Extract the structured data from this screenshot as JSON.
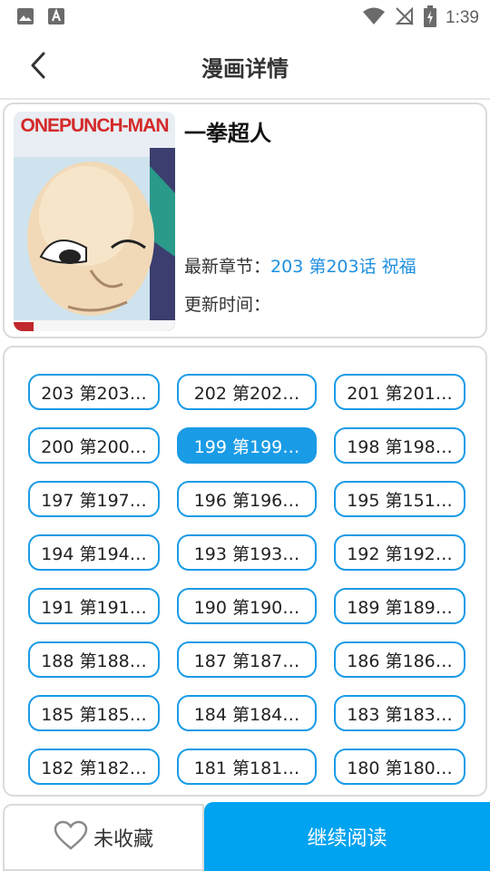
{
  "status_bar": {
    "time": "1:39",
    "icons": [
      "image-icon",
      "text-a-icon",
      "wifi-icon",
      "no-signal-icon",
      "battery-charging-icon"
    ]
  },
  "header": {
    "title": "漫画详情",
    "back_icon": "chevron-left-icon"
  },
  "comic": {
    "title": "一拳超人",
    "cover_logo": "ONEPUNCH-MAN",
    "latest_label": "最新章节：",
    "latest_value": "203 第203话 祝福",
    "update_label": "更新时间：",
    "update_value": ""
  },
  "chapters": [
    {
      "label": "203 第203…",
      "active": false
    },
    {
      "label": "202 第202…",
      "active": false
    },
    {
      "label": "201 第201…",
      "active": false
    },
    {
      "label": "200 第200…",
      "active": false
    },
    {
      "label": "199 第199…",
      "active": true
    },
    {
      "label": "198 第198…",
      "active": false
    },
    {
      "label": "197 第197…",
      "active": false
    },
    {
      "label": "196 第196…",
      "active": false
    },
    {
      "label": "195 第151…",
      "active": false
    },
    {
      "label": "194 第194…",
      "active": false
    },
    {
      "label": "193 第193…",
      "active": false
    },
    {
      "label": "192 第192…",
      "active": false
    },
    {
      "label": "191 第191…",
      "active": false
    },
    {
      "label": "190 第190…",
      "active": false
    },
    {
      "label": "189 第189…",
      "active": false
    },
    {
      "label": "188 第188…",
      "active": false
    },
    {
      "label": "187 第187…",
      "active": false
    },
    {
      "label": "186 第186…",
      "active": false
    },
    {
      "label": "185 第185…",
      "active": false
    },
    {
      "label": "184 第184…",
      "active": false
    },
    {
      "label": "183 第183…",
      "active": false
    },
    {
      "label": "182 第182…",
      "active": false
    },
    {
      "label": "181 第181…",
      "active": false
    },
    {
      "label": "180 第180…",
      "active": false
    }
  ],
  "bottom": {
    "favorite_label": "未收藏",
    "favorite_icon": "heart-outline-icon",
    "read_label": "继续阅读"
  },
  "colors": {
    "accent": "#1a9be6",
    "read_button": "#00a3f0",
    "link": "#1e90e0",
    "border": "#dadada"
  }
}
